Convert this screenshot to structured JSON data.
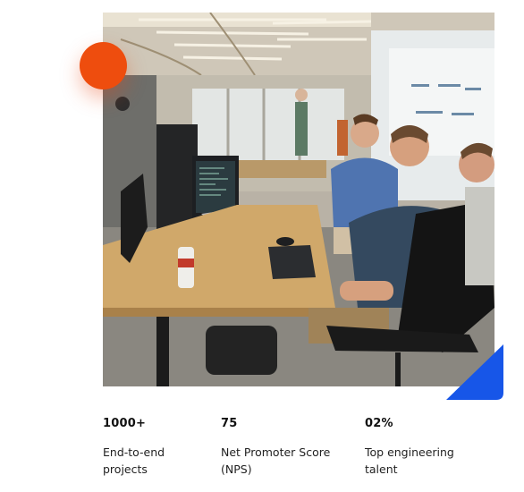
{
  "colors": {
    "accent_orange": "#EE4D0E",
    "accent_blue": "#1756E8",
    "text_primary": "#111111",
    "background": "#FFFFFF"
  },
  "image": {
    "icon": "office-team-photo"
  },
  "stats": [
    {
      "value": "1000+",
      "label_line1": "End-to-end",
      "label_line2": "projects"
    },
    {
      "value": "75",
      "label_line1": "Net Promoter Score",
      "label_line2": "(NPS)"
    },
    {
      "value": "02%",
      "label_line1": "Top engineering",
      "label_line2": "talent"
    }
  ]
}
